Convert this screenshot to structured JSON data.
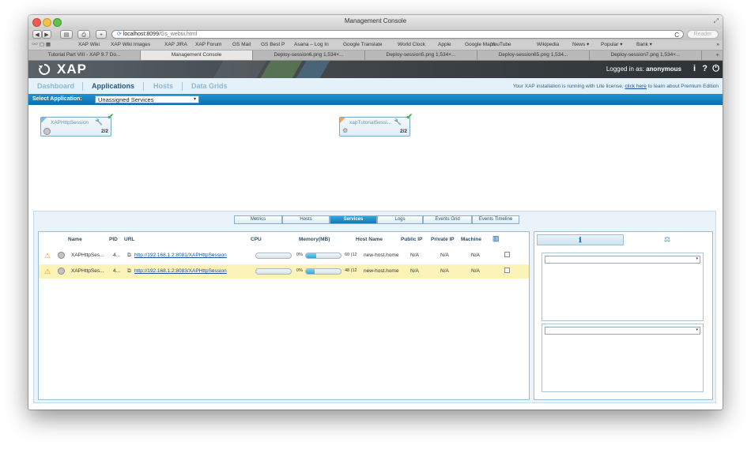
{
  "window": {
    "title": "Management Console"
  },
  "toolbar": {
    "url_host": "localhost:8099",
    "url_path": "/Gs_webui.html",
    "reader_label": "Reader",
    "back_glyph": "◀",
    "forward_glyph": "▶",
    "add_glyph": "+",
    "refresh_glyph": "C"
  },
  "bookmarks": [
    "XAP Wiki",
    "XAP Wiki Images",
    "XAP JIRA",
    "XAP Forum",
    "GS Mail",
    "GS Best P",
    "Asana – Log In",
    "Google Translate",
    "World Clock",
    "Apple",
    "Google Maps",
    "YouTube",
    "Wikipedia",
    "News ▾",
    "Popular ▾",
    "Bank ▾"
  ],
  "tabs": [
    {
      "label": "Tutorial Part VIII - XAP 9.7 Do..."
    },
    {
      "label": "Management Console"
    },
    {
      "label": "Deploy-session6.png 1,534×..."
    },
    {
      "label": "Deploy-session5.png 1,534×..."
    },
    {
      "label": "Deploy-session65.png 1,534..."
    },
    {
      "label": "Deploy-session7.png 1,534×..."
    }
  ],
  "header": {
    "logo": "XAP",
    "logged_prefix": "Logged in as:",
    "user": "anonymous",
    "info_glyph": "i",
    "help_glyph": "?",
    "power_glyph": "⏻"
  },
  "nav": {
    "items": [
      "Dashboard",
      "Applications",
      "Hosts",
      "Data Grids"
    ],
    "license_text": "Your XAP installation is running with Lite license,",
    "license_link": "click here",
    "license_suffix": "to learn about Premium Edition"
  },
  "appbar": {
    "label": "Select Application:",
    "selected": "Unassigned Services"
  },
  "topology": [
    {
      "name": "XAPHttpSession",
      "count": "2/2",
      "accent": "#7fb9e4"
    },
    {
      "name": "xapTutorialSessi...",
      "count": "2/2",
      "accent": "#f0a35a"
    }
  ],
  "subtabs": [
    "Metrics",
    "Hosts",
    "Services",
    "Logs",
    "Events Grid",
    "Events Timeline"
  ],
  "grid": {
    "headers": [
      "Name",
      "PID",
      "URL",
      "CPU",
      "Memory(MB)",
      "Host Name",
      "Public IP",
      "Private IP",
      "Machine"
    ],
    "rows": [
      {
        "name": "XAPHttpSes...",
        "pid": "4...",
        "url": "http://192.168.1.2:8081/XAPHttpSession",
        "cpu_label": "0%",
        "mem_label": "60 (12",
        "mem_pct": 0.3,
        "host": "new-host.home",
        "public_ip": "N/A",
        "private_ip": "N/A",
        "machine": "N/A",
        "selected": false
      },
      {
        "name": "XAPHttpSes...",
        "pid": "4...",
        "url": "http://192.168.1.2:8083/XAPHttpSession",
        "cpu_label": "0%",
        "mem_label": "48 (12",
        "mem_pct": 0.26,
        "host": "new-host.home",
        "public_ip": "N/A",
        "private_ip": "N/A",
        "machine": "N/A",
        "selected": true
      }
    ]
  }
}
